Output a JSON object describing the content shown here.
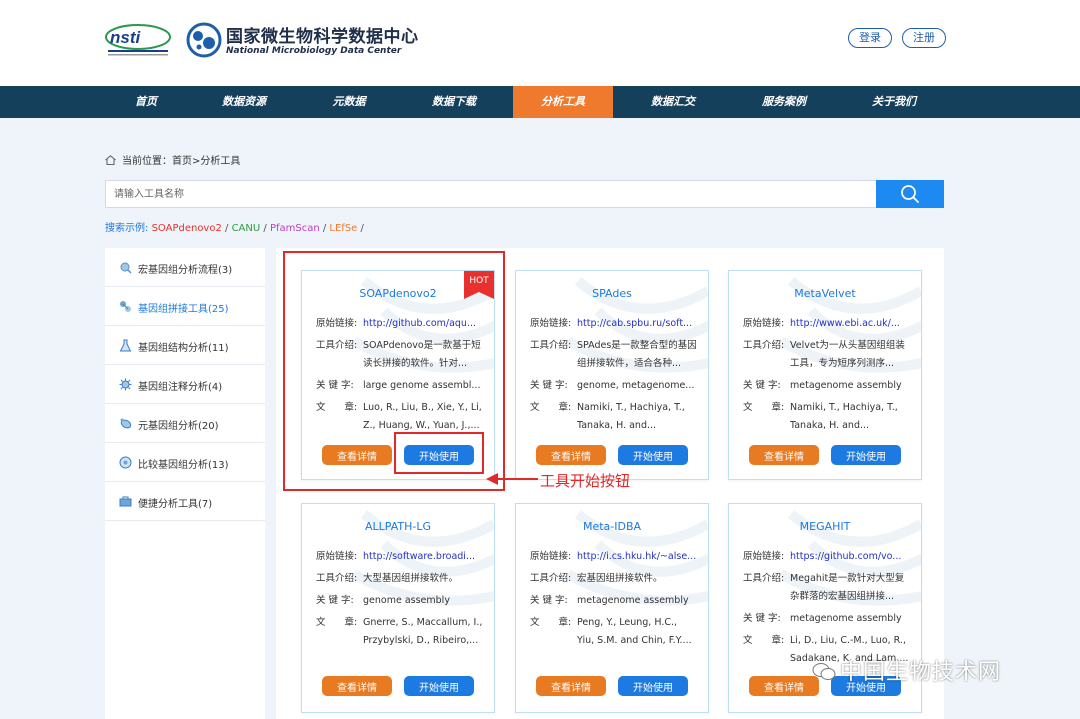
{
  "header": {
    "nsti_logo_text": "nsti",
    "brand_cn": "国家微生物科学数据中心",
    "brand_en": "National Microbiology Data Center",
    "login_label": "登录",
    "register_label": "注册"
  },
  "nav": {
    "items": [
      {
        "label": "首页"
      },
      {
        "label": "数据资源"
      },
      {
        "label": "元数据"
      },
      {
        "label": "数据下载"
      },
      {
        "label": "分析工具"
      },
      {
        "label": "数据汇交"
      },
      {
        "label": "服务案例"
      },
      {
        "label": "关于我们"
      }
    ],
    "active": "分析工具"
  },
  "breadcrumb": {
    "prefix": "当前位置：",
    "path": "首页>分析工具"
  },
  "search": {
    "placeholder": "请输入工具名称",
    "examples_label": "搜索示例:",
    "examples": [
      "SOAPdenovo2",
      "CANU",
      "PfamScan",
      "LEfSe"
    ],
    "example_colors": [
      "#e8312e",
      "#2e9e3b",
      "#c040c0",
      "#ef7a2e"
    ],
    "separator": " / "
  },
  "sidebar": {
    "items": [
      {
        "label": "宏基因组分析流程(3)",
        "icon": "magnify-icon"
      },
      {
        "label": "基因组拼接工具(25)",
        "icon": "assembly-icon"
      },
      {
        "label": "基因组结构分析(11)",
        "icon": "flask-icon"
      },
      {
        "label": "基因组注释分析(4)",
        "icon": "virus-icon"
      },
      {
        "label": "元基因组分析(20)",
        "icon": "microbe-icon"
      },
      {
        "label": "比较基因组分析(13)",
        "icon": "compare-icon"
      },
      {
        "label": "便捷分析工具(7)",
        "icon": "toolbox-icon"
      }
    ],
    "active_index": 1
  },
  "labels": {
    "link": "原始链接:",
    "intro": "工具介绍:",
    "keyword": "关 键 字:",
    "article": "文　　章:",
    "detail_btn": "查看详情",
    "start_btn": "开始使用",
    "hot": "HOT"
  },
  "cards": [
    {
      "title": "SOAPdenovo2",
      "link": "http://github.com/aqu...",
      "intro": "SOAPdenovo是一款基于短读长拼接的软件。针对...",
      "keyword": "large genome assembl...",
      "article": "Luo, R., Liu, B., Xie, Y., Li, Z., Huang, W., Yuan, J.,...",
      "hot": true
    },
    {
      "title": "SPAdes",
      "link": "http://cab.spbu.ru/soft...",
      "intro": "SPAdes是一款整合型的基因组拼接软件，适合各种...",
      "keyword": "genome, metagenome...",
      "article": "Namiki, T., Hachiya, T., Tanaka, H. and...",
      "hot": false
    },
    {
      "title": "MetaVelvet",
      "link": "http://www.ebi.ac.uk/...",
      "intro": "Velvet为一从头基因组组装工具，专为短序列测序...",
      "keyword": "metagenome assembly",
      "article": "Namiki, T., Hachiya, T., Tanaka, H. and...",
      "hot": false
    },
    {
      "title": "ALLPATH-LG",
      "link": "http://software.broadi...",
      "intro": "大型基因组拼接软件。",
      "keyword": "genome assembly",
      "article": "Gnerre, S., Maccallum, I., Przybylski, D., Ribeiro,...",
      "hot": false
    },
    {
      "title": "Meta-IDBA",
      "link": "http://i.cs.hku.hk/~alse...",
      "intro": "宏基因组拼接软件。",
      "keyword": "metagenome assembly",
      "article": "Peng, Y., Leung, H.C., Yiu, S.M. and Chin, F.Y....",
      "hot": false
    },
    {
      "title": "MEGAHIT",
      "link": "https://github.com/vo...",
      "intro": "Megahit是一款针对大型复杂群落的宏基因组拼接...",
      "keyword": "metagenome assembly",
      "article": "Li, D., Liu, C.-M., Luo, R., Sadakane, K. and Lam,...",
      "hot": false
    }
  ],
  "annotation": {
    "text": "工具开始按钮",
    "color": "#e02a2a"
  },
  "watermark": {
    "text": "中国生物技术网"
  },
  "colors": {
    "nav_bg": "#15405c",
    "nav_active": "#ef7a2e",
    "primary_blue": "#1c7ae0",
    "detail_orange": "#e87a22"
  }
}
